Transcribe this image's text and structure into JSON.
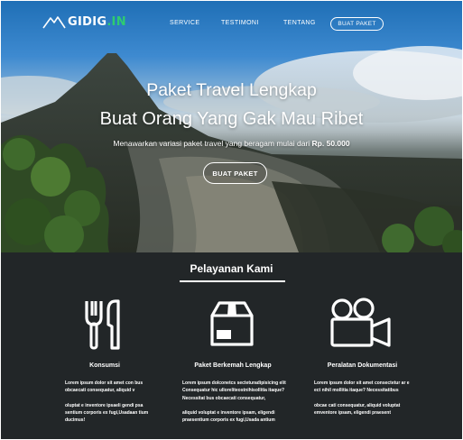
{
  "nav": {
    "logo_main": "GIDIG",
    "logo_accent": ".IN",
    "links": [
      "SERVICE",
      "TESTIMONI",
      "TENTANG"
    ],
    "cta": "BUAT PAKET"
  },
  "hero": {
    "title_line1": "Paket Travel Lengkap",
    "title_line2": "Buat Orang Yang Gak Mau Ribet",
    "subtitle_prefix": "Menawarkan variasi paket travel yang beragam mulai dari ",
    "subtitle_price": "Rp. 50.000",
    "button": "BUAT PAKET"
  },
  "services": {
    "title": "Pelayanan Kami",
    "items": [
      {
        "name": "Konsumsi",
        "icon": "fork-knife-icon",
        "desc1": "Lorem ipsum dolor sit amet con bus obcaecati consequatur, aliquid v",
        "desc2": "oluptat e inventore ipsaeli gendi psa sentium corporis ex fugi,Usadaan tium ducimus!"
      },
      {
        "name": "Paket Berkemah Lengkap",
        "icon": "package-box-icon",
        "desc1": "Lorem ipsum dolconetcs secteturadipisicing elit Consequatur hic ulloreliteostnihisollitia itaque? Necessitat bus obcaecati consequatur,",
        "desc2": "aliquid voluptat e inventore ipsam, eligendi praesentium corporis ex fugi,Usada antium"
      },
      {
        "name": "Peralatan Dokumentasi",
        "icon": "video-camera-icon",
        "desc1": "Lorem ipsum dolor sit amet consectetur ar e ect nihil mollitia itaque? Necessitatibus",
        "desc2": "obcae cati consequatur, aliquid voluptat emventore ipsam, eligendi praesent"
      }
    ]
  }
}
